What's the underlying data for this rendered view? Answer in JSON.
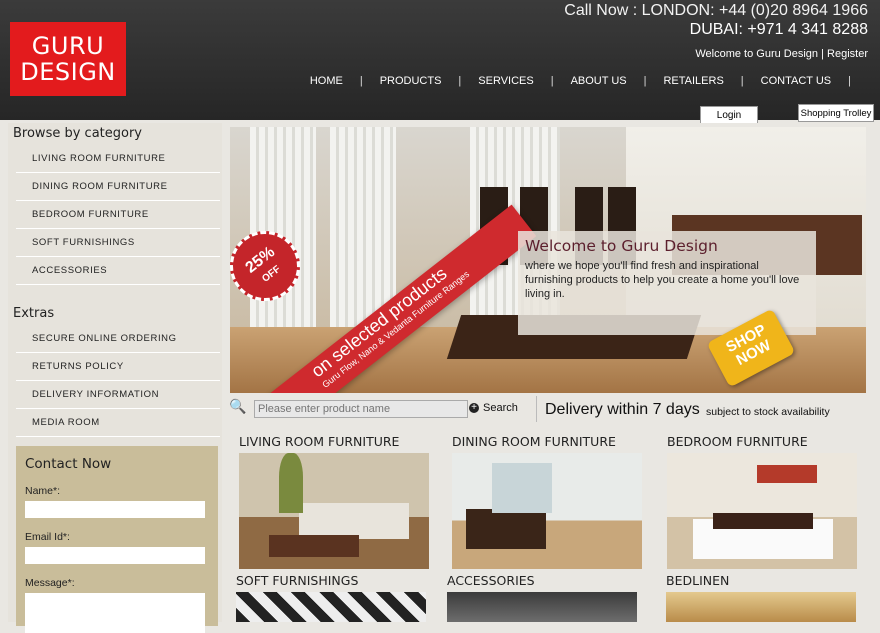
{
  "header": {
    "logo_line1": "GURU",
    "logo_line2": "DESIGN",
    "call_line1": "Call Now : LONDON: +44 (0)20 8964 1966",
    "call_line2": "DUBAI: +971 4 341 8288",
    "welcome_link": "Welcome to Guru Design",
    "separator": " | ",
    "register_link": "Register",
    "nav": [
      "HOME",
      "PRODUCTS",
      "SERVICES",
      "ABOUT US",
      "RETAILERS",
      "CONTACT US"
    ],
    "nav_sep": "|",
    "login_tab": "Login",
    "trolley_tab": "Shopping Trolley"
  },
  "sidebar": {
    "browse_heading": "Browse by category",
    "categories": [
      "LIVING ROOM FURNITURE",
      "DINING ROOM FURNITURE",
      "BEDROOM FURNITURE",
      "SOFT FURNISHINGS",
      "ACCESSORIES"
    ],
    "extras_heading": "Extras",
    "extras": [
      "SECURE ONLINE ORDERING",
      "RETURNS POLICY",
      "DELIVERY INFORMATION",
      "MEDIA ROOM"
    ],
    "contact": {
      "heading": "Contact Now",
      "name_label": "Name*:",
      "email_label": "Email Id*:",
      "message_label": "Message*:"
    }
  },
  "banner": {
    "ribbon_text": "on selected products",
    "ribbon_sub": "Guru Flow, Nano & Vedanta Furniture Ranges",
    "off_pct": "25%",
    "off_word": "OFF",
    "welcome_title": "Welcome to Guru Design",
    "welcome_body": "where we hope you'll find fresh and inspirational furnishing products to help you create a home you'll love living in.",
    "shop_now_line1": "SHOP",
    "shop_now_line2": "NOW"
  },
  "search": {
    "placeholder": "Please enter product name",
    "button_label": "Search",
    "delivery_text": "Delivery within 7 days",
    "delivery_sub": "subject to stock availability"
  },
  "categories_grid": [
    {
      "title": "LIVING ROOM FURNITURE"
    },
    {
      "title": "DINING ROOM FURNITURE"
    },
    {
      "title": "BEDROOM FURNITURE"
    },
    {
      "title": "SOFT FURNISHINGS"
    },
    {
      "title": "ACCESSORIES"
    },
    {
      "title": "BEDLINEN"
    }
  ],
  "colors": {
    "brand_red": "#e31b1d",
    "header_dark": "#2b2b2b",
    "contact_panel": "#c9bd9a"
  }
}
